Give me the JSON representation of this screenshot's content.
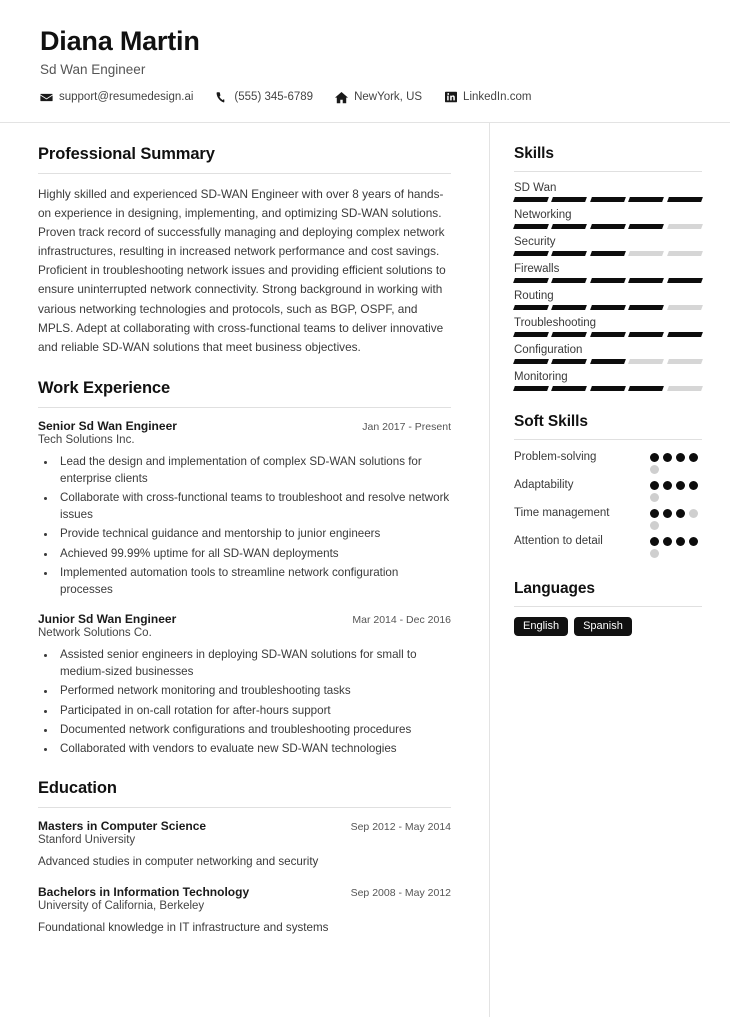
{
  "header": {
    "name": "Diana Martin",
    "job_title": "Sd Wan Engineer",
    "contacts": [
      {
        "icon": "envelope-icon",
        "text": "support@resumedesign.ai"
      },
      {
        "icon": "phone-icon",
        "text": "(555) 345-6789"
      },
      {
        "icon": "home-icon",
        "text": "NewYork, US"
      },
      {
        "icon": "linkedin-icon",
        "text": "LinkedIn.com"
      }
    ]
  },
  "main": {
    "summary": {
      "title": "Professional Summary",
      "text": "Highly skilled and experienced SD-WAN Engineer with over 8 years of hands-on experience in designing, implementing, and optimizing SD-WAN solutions. Proven track record of successfully managing and deploying complex network infrastructures, resulting in increased network performance and cost savings. Proficient in troubleshooting network issues and providing efficient solutions to ensure uninterrupted network connectivity. Strong background in working with various networking technologies and protocols, such as BGP, OSPF, and MPLS. Adept at collaborating with cross-functional teams to deliver innovative and reliable SD-WAN solutions that meet business objectives."
    },
    "experience": {
      "title": "Work Experience",
      "entries": [
        {
          "role": "Senior Sd Wan Engineer",
          "date": "Jan 2017 - Present",
          "org": "Tech Solutions Inc.",
          "bullets": [
            "Lead the design and implementation of complex SD-WAN solutions for enterprise clients",
            "Collaborate with cross-functional teams to troubleshoot and resolve network issues",
            "Provide technical guidance and mentorship to junior engineers",
            "Achieved 99.99% uptime for all SD-WAN deployments",
            "Implemented automation tools to streamline network configuration processes"
          ]
        },
        {
          "role": "Junior Sd Wan Engineer",
          "date": "Mar 2014 - Dec 2016",
          "org": "Network Solutions Co.",
          "bullets": [
            "Assisted senior engineers in deploying SD-WAN solutions for small to medium-sized businesses",
            "Performed network monitoring and troubleshooting tasks",
            "Participated in on-call rotation for after-hours support",
            "Documented network configurations and troubleshooting procedures",
            "Collaborated with vendors to evaluate new SD-WAN technologies"
          ]
        }
      ]
    },
    "education": {
      "title": "Education",
      "entries": [
        {
          "degree": "Masters in Computer Science",
          "date": "Sep 2012 - May 2014",
          "school": "Stanford University",
          "description": "Advanced studies in computer networking and security"
        },
        {
          "degree": "Bachelors in Information Technology",
          "date": "Sep 2008 - May 2012",
          "school": "University of California, Berkeley",
          "description": "Foundational knowledge in IT infrastructure and systems"
        }
      ]
    }
  },
  "sidebar": {
    "skills": {
      "title": "Skills",
      "max": 5,
      "items": [
        {
          "name": "SD Wan",
          "level": 5
        },
        {
          "name": "Networking",
          "level": 4
        },
        {
          "name": "Security",
          "level": 3
        },
        {
          "name": "Firewalls",
          "level": 5
        },
        {
          "name": "Routing",
          "level": 4
        },
        {
          "name": "Troubleshooting",
          "level": 5
        },
        {
          "name": "Configuration",
          "level": 3
        },
        {
          "name": "Monitoring",
          "level": 4
        }
      ]
    },
    "soft_skills": {
      "title": "Soft Skills",
      "max": 5,
      "items": [
        {
          "name": "Problem-solving",
          "level": 4
        },
        {
          "name": "Adaptability",
          "level": 4
        },
        {
          "name": "Time management",
          "level": 3
        },
        {
          "name": "Attention to detail",
          "level": 4
        }
      ]
    },
    "languages": {
      "title": "Languages",
      "items": [
        "English",
        "Spanish"
      ]
    }
  },
  "colors": {
    "accent": "#0d0d0d",
    "muted": "#d6d6d6",
    "rule": "#e0e0e0"
  }
}
